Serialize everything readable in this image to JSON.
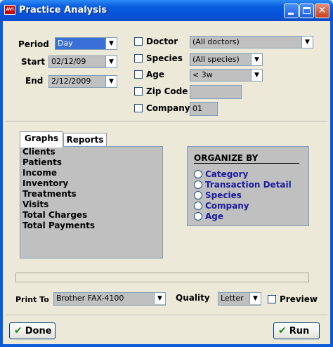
{
  "window": {
    "title": "Practice Analysis",
    "app_icon": "AVI"
  },
  "filters": {
    "period_label": "Period",
    "period_value": "Day",
    "start_label": "Start",
    "start_value": "02/12/09",
    "end_label": "End",
    "end_value": "2/12/2009",
    "doctor_label": "Doctor",
    "doctor_value": "(All doctors)",
    "species_label": "Species",
    "species_value": "(All species)",
    "age_label": "Age",
    "age_value": "< 3w",
    "zip_label": "Zip Code",
    "zip_value": "",
    "company_label": "Company",
    "company_value": "01"
  },
  "tabs": [
    {
      "label": "Graphs"
    },
    {
      "label": "Reports"
    }
  ],
  "list_items": [
    "Clients",
    "Patients",
    "Income",
    "Inventory",
    "Treatments",
    "Visits",
    "Total Charges",
    "Total Payments"
  ],
  "organize": {
    "title": "ORGANIZE BY",
    "options": [
      "Category",
      "Transaction Detail",
      "Species",
      "Company",
      "Age"
    ]
  },
  "print": {
    "print_to_label": "Print To",
    "printer_value": "Brother FAX-4100",
    "quality_label": "Quality",
    "quality_value": "Letter",
    "preview_label": "Preview"
  },
  "buttons": {
    "done": "Done",
    "run": "Run"
  },
  "icons": {
    "checkmark": "checkmark-icon",
    "dropdown": "chevron-down-icon"
  },
  "colors": {
    "titlebar": "#0752d8",
    "background": "#ece9d8",
    "field": "#c0c0c0",
    "selected": "#3a6fd8",
    "option_text": "#1a1aa0"
  }
}
